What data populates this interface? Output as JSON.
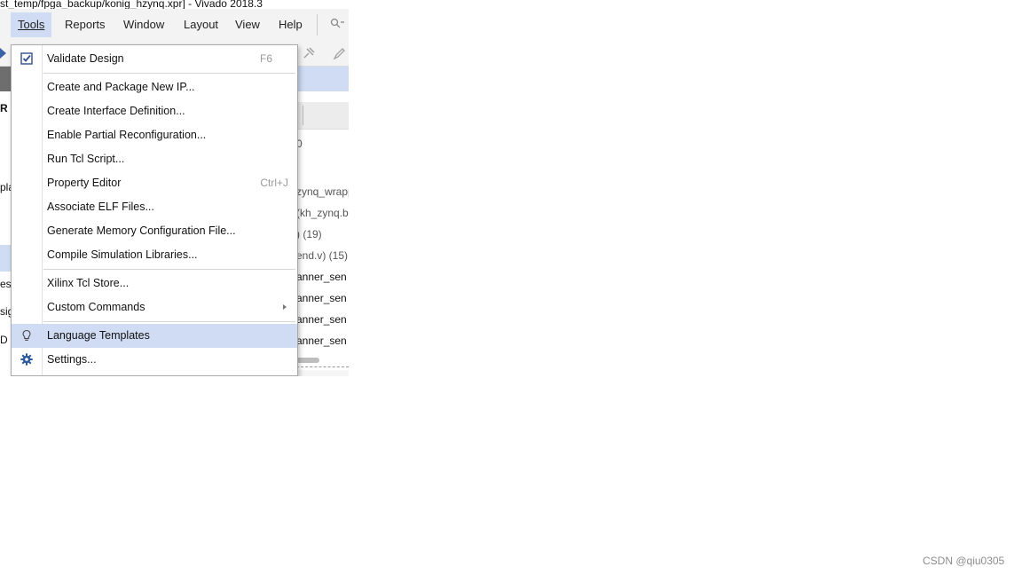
{
  "window": {
    "title": "st_temp/fpga_backup/konig_hzynq.xpr] - Vivado 2018.3"
  },
  "menubar": {
    "items": [
      {
        "label": "Tools",
        "active": true
      },
      {
        "label": "Reports"
      },
      {
        "label": "Window"
      },
      {
        "label": "Layout"
      },
      {
        "label": "View"
      },
      {
        "label": "Help"
      }
    ],
    "quick_access": {
      "icon": "search-icon",
      "text": "Q"
    }
  },
  "left_panel": {
    "texts": [
      "R",
      "pla",
      "es",
      "sig",
      "D"
    ]
  },
  "right_panel": {
    "texts": [
      "0",
      "zynq_wrapp",
      "(kh_zynq.b",
      ") (19)",
      "end.v) (15)",
      "anner_sen",
      "anner_sen",
      "anner_sen",
      "anner_sen"
    ]
  },
  "tools_menu": {
    "items": [
      {
        "label": "Validate Design",
        "shortcut": "F6",
        "icon": "checkbox-icon"
      },
      {
        "label": "Create and Package New IP..."
      },
      {
        "label": "Create Interface Definition..."
      },
      {
        "label": "Enable Partial Reconfiguration..."
      },
      {
        "label": "Run Tcl Script..."
      },
      {
        "label": "Property Editor",
        "shortcut": "Ctrl+J"
      },
      {
        "label": "Associate ELF Files..."
      },
      {
        "label": "Generate Memory Configuration File..."
      },
      {
        "label": "Compile Simulation Libraries..."
      },
      {
        "label": "Xilinx Tcl Store..."
      },
      {
        "label": "Custom Commands",
        "submenu": true
      },
      {
        "label": "Language Templates",
        "icon": "lightbulb-icon",
        "highlighted": true
      },
      {
        "label": "Settings...",
        "icon": "gear-icon"
      }
    ]
  },
  "watermark": "CSDN @qiu0305",
  "colors": {
    "highlight": "#cfdcf3",
    "accent": "#3a64a8"
  }
}
